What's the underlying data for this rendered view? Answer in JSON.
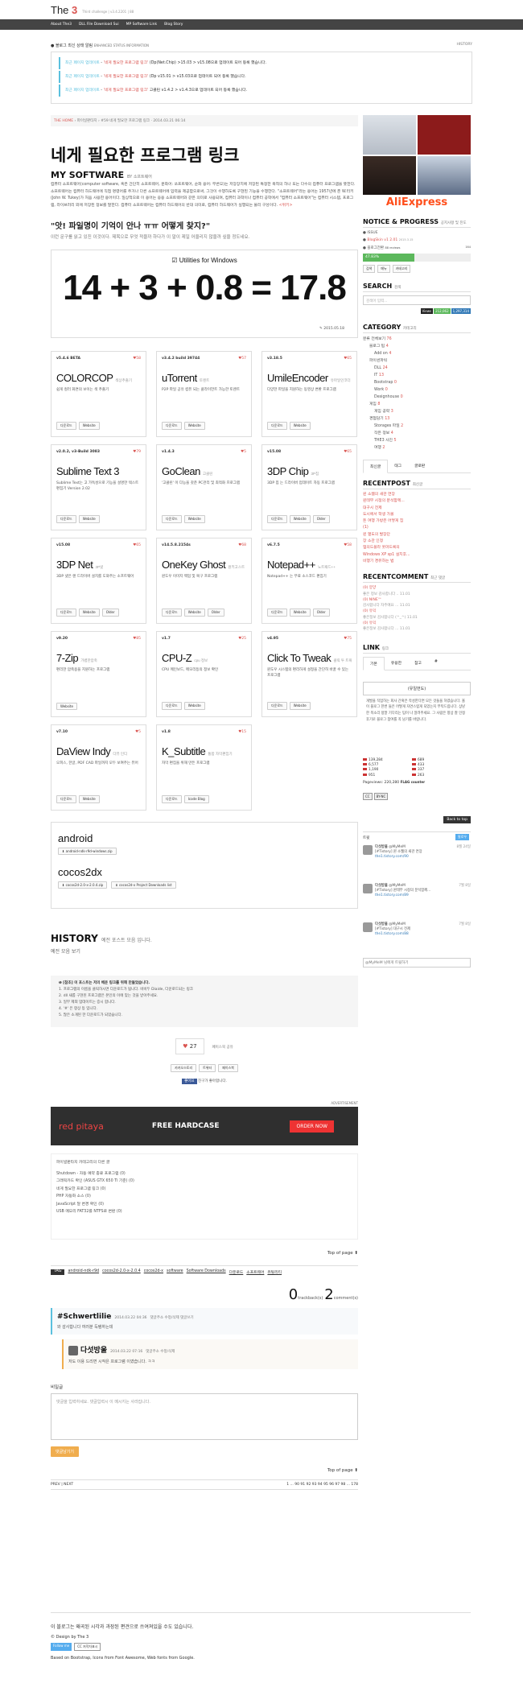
{
  "header": {
    "brand_prefix": "The",
    "brand_suffix": "3",
    "tagline": "Third challenge | v3.4.2201 | 88",
    "nav": [
      "About The3",
      "DLL File Download Sui",
      "MP Software Link",
      "Blog Story"
    ]
  },
  "status": {
    "title": "블로그 최신 상태 알림",
    "title_en": "ENHANCED STATUS INFORMATION",
    "history": "HISTORY",
    "items": [
      {
        "pre": "최근 페이지 업데이트",
        "link": "'네게 필요한 프로그램 링크'",
        "text": "(Dp(Net.Chip) >15.03 > v15.08으로 업데이트 되어 등록 했습니다."
      },
      {
        "pre": "최근 페이지 업데이트",
        "link": "'네게 필요한 프로그램 링크'",
        "text": "(Dp v15.01 > v15.03으로 업데이트 되어 등록 했습니다."
      },
      {
        "pre": "최근 페이지 업데이트",
        "link": "'네게 필요한 프로그램 링크'",
        "text": "고클린 v1.4.2 > v1.4.3으로 업데이트 되어 등록 했습니다."
      }
    ]
  },
  "breadcrumb": {
    "home": "THE HOME",
    "cat": "파이널판타지",
    "post": "#59 네게 필요한 프로그램 링크",
    "date": "2014.03.21 06:14"
  },
  "post": {
    "title": "네게 필요한 프로그램 링크",
    "subtitle": "MY SOFTWARE",
    "subtitle_small": "BY 소프트웨어",
    "intro": "컴퓨터 소프트웨어(computer software, 혹은 간단히 소프트웨어, 문화어: 쏘프트웨어, 순화 용어: 무른모)는 저장장치에 저장된 특정한 목적의 하나 또는 다수의 컴퓨터 프로그램을 뜻한다. 소프트웨어는 컴퓨터 하드웨어에 직접 명령어를 주거나 다른 소프트웨어에 입력을 제공함으로써, 그것이 수행하도록 구현된 기능을 수행한다. \"소프트웨어\"라는 용어는 1957년에 존 W.터키(John W. Tukey)가 처음 사용한 용어이다. 일상적으로 이 용어는 응용 소프트웨어와 같은 의미로 사용되며, 컴퓨터 과학이나 컴퓨터 공학에서 \"컴퓨터 소프트웨어\"는 컴퓨터 시스템, 프로그램, 라이브러리 외에 저장된 정보를 말한다. 컴퓨터 소프트웨어는 컴퓨터 하드웨어의 반대 의미로, 컴퓨터 하드웨어가 실행되는 물리 구성이다.",
    "intro_link": "<위키>",
    "q_title": "\"앗! 파일명이 기억이 안나 ㅠㅠ 어떻게 찾지?\"",
    "q_sub": "이런 문구를 읽고 있진 이것이다. 제목으로 무엇 적을까 하다가 이 말이 제일 어울리지 않을까 싶을 정도네요."
  },
  "utilities": {
    "label": "Utilities for Windows",
    "equation": "14 + 3 + 0.8 = 17.8",
    "date": "2015.05.18"
  },
  "cards": [
    {
      "ver": "v5.4.6 BETA",
      "likes": "58",
      "name": "COLORCOP",
      "small": "색상추출기",
      "desc": "쉽게 컬러 화면의 보이는 색 추출기",
      "btns": [
        "다운로드",
        "Website"
      ]
    },
    {
      "ver": "v3.4.2 build 39744",
      "likes": "57",
      "name": "uTorrent",
      "small": "토렌트",
      "desc": "P2P 파일 공유 컴퓨 되는 클라이언트 가능한 토렌트",
      "btns": [
        "다운로드",
        "Website"
      ]
    },
    {
      "ver": "v3.18.5",
      "likes": "65",
      "name": "UmileEncoder",
      "small": "유마일인코더",
      "desc": "다양한 파일을 지원하는 동영상 변환 프로그램",
      "btns": [
        "다운로드",
        "Website"
      ]
    },
    {
      "ver": "v2.0.2, v3-Build 3083",
      "likes": "79",
      "name": "Sublime Text 3",
      "small": "",
      "desc": "Sublime Text는 고 가독성으로 기능을 설명한 텍스트 편집기 Version 2.02",
      "btns": [
        "다운로드",
        "Website"
      ]
    },
    {
      "ver": "v1.4.3",
      "likes": "5",
      "name": "GoClean",
      "small": "고클린",
      "desc": "'고클린' 이 다능을 갖춘 PC관리 및 최적화 프로그램",
      "btns": [
        "다운로드",
        "Website"
      ]
    },
    {
      "ver": "v15.08",
      "likes": "65",
      "name": "3DP Chip",
      "small": "3P칩",
      "desc": "3DP 칩 는 드라이버 업데이트 자동 프로그램",
      "btns": [
        "다운로드",
        "Website",
        "Older"
      ]
    },
    {
      "ver": "v15.08",
      "likes": "65",
      "name": "3DP Net",
      "small": "3P넷",
      "desc": "3DP 넷은 랜 드라이버 설치를 도와주는 소프트웨어",
      "btns": [
        "다운로드",
        "Website",
        "Older"
      ]
    },
    {
      "ver": "v14.5.8.2154s",
      "likes": "68",
      "name": "OneKey Ghost",
      "small": "원키고스트",
      "desc": "윈도우 이미지 백업 및 복구 프로그램",
      "btns": [
        "다운로드",
        "Website",
        "Older"
      ]
    },
    {
      "ver": "v6.7.5",
      "likes": "58",
      "name": "Notepad++",
      "small": "노트패드++",
      "desc": "Notepad++ 는 무료 소스코드 편집기",
      "btns": [
        "다운로드",
        "Website",
        "Older"
      ]
    },
    {
      "ver": "v9.20",
      "likes": "85",
      "name": "7-Zip",
      "small": "가볍한압축",
      "desc": "편리한 압축용을 지원하는 프로그램",
      "btns": [
        "Website"
      ]
    },
    {
      "ver": "v1.7",
      "likes": "25",
      "name": "CPU-Z",
      "small": "cpu 정보",
      "desc": "CPU 메인보드, 메모리등의 정보 확인",
      "btns": [
        "다운로드",
        "Website"
      ]
    },
    {
      "ver": "v4.95",
      "likes": "75",
      "name": "Click To Tweak",
      "small": "클릭 투 트윅",
      "desc": "윈도우 시스템의 편리하게 설정을 간단히 바꿀 수 있는 프로그램",
      "btns": [
        "다운로드",
        "Website"
      ]
    },
    {
      "ver": "v7.10",
      "likes": "5",
      "name": "DaView Indy",
      "small": "다뷰 인디",
      "desc": "오피스, 한글, PDF CAD 파일까지 모두 보여주는 뷰어",
      "btns": [
        "다운로드",
        "Website"
      ]
    },
    {
      "ver": "v1.8",
      "likes": "15",
      "name": "K_Subtitle",
      "small": "통합 자막편집기",
      "desc": "자막 편집을 위해 만든 프로그램",
      "btns": [
        "다운로드",
        "Icode Blog"
      ]
    }
  ],
  "android": {
    "title": "android",
    "btn1": "android-ndk-r9d-windows.zip",
    "title2": "cocos2dx",
    "btn2": "cocos2d-2.0-x-2.0.4.zip",
    "btn3": "cocos2d-x Project Downloads list"
  },
  "history": {
    "title": "HISTORY",
    "title_small": "예전 포스트 모음 입니다.",
    "text": "예전 모음 보기"
  },
  "notice": {
    "head": "[참조] 이 포스트는 저의 배운 링크를 위해 만들었습니다.",
    "lines": [
      "1. 프로그램의 이름을 클릭하시면 다운로드가 됩니다. 비비두 Diaide, 다운로드되는 링크",
      "2. dll 새롭 구현된 프로그램은 본인의 이에 맞는 것을 받아주세요.",
      "3. 일부 제외 업데이트는 증시 합니다.",
      "4. '#' 은 항상 등 입니다.",
      "5. 많은 소개된 한 다운로드가 되었습니다."
    ]
  },
  "like": {
    "count": "27",
    "text": "페이스북 공유"
  },
  "shares": [
    "카카오스토리",
    "트위터",
    "페이스북"
  ],
  "fb": {
    "btn": "좋아요",
    "text": "친구가 좋아합니다."
  },
  "ad": {
    "label": "ADVERTISEMENT",
    "logo": "red pitaya",
    "headline": "FREE HARDCASE",
    "order": "ORDER NOW"
  },
  "related": {
    "head": "파이널판타지 카테고리의 다른 글",
    "items": [
      "Shutdown - 자동 예약 종료 프로그램 (0)",
      "그래픽카드 확인 (ASUS GTX 650 Ti 기준) (0)",
      "네게 필요한 프로그램 링크 (0)",
      "PHP 자동화 소스 (0)",
      "JavaScript 달 변경 확인 (0)",
      "USB 메모리 FAT32를 NTFS로 변환 (0)"
    ]
  },
  "top": "Top of page",
  "tags": {
    "label": "TAG",
    "items": [
      "android-ndk-r9d",
      "cocos2d-2.0-x-2.0.4",
      "cocos2d-x",
      "software",
      "Software Downloads",
      "다운로드",
      "소프트웨어",
      "유틸리티"
    ]
  },
  "trackback": {
    "tb_count": "0",
    "tb_label": "trackback(s)",
    "c_count": "2",
    "c_label": "comment(s)"
  },
  "comments": [
    {
      "name": "#Schwertlilie",
      "date": "2014.03.22 04:36",
      "actions": "댓글주소 수정/삭제 댓글쓰기",
      "text": "와 감사합니다 여러분 득템하는데"
    },
    {
      "name": "다섯방울",
      "date": "2014.03.22 07:16",
      "actions": "댓글주소 수정/삭제",
      "text": "저도 이용 드리면 시작은 프로그램 이였습니다. ㅋㅋ"
    }
  ],
  "comment_form": {
    "label": "비밀글",
    "placeholder": "댓글을 입력하세요. 댓글입력시 이 메시지는 사라집니다.",
    "submit": "댓글남기기"
  },
  "pager": {
    "prev": "PREV | NEXT",
    "pages": "1 ... 90 91 92 93 94 95 96 97 98 ... 178"
  },
  "footer": {
    "line1": "이 블로그는 왜곡된 시각과 과장된 편견으로 쓰여져있을 수도 있습니다.",
    "design": "© Design by The 3",
    "badges": [
      "Follow me",
      "CC 저작자표시"
    ],
    "credit": "Based on Bootstrap, Icons from Font Awesome, Web fonts from Google."
  },
  "sidebar": {
    "aliexpress": "AliExpress",
    "notice_title": "NOTICE",
    "progress_title": "PROGRESS",
    "notice_small": "공지사항 및 진도",
    "notice_items": [
      "ISSUE",
      "BlogSkin v1 2.01",
      "2015.3.15"
    ],
    "progress_label": "블로그전환",
    "progress_count": "88 reviews",
    "progress_max": "164",
    "progress_pct": "47.83%",
    "progress_value": 0.4783,
    "sel": [
      "검색",
      "메뉴",
      "카테고리"
    ],
    "search_title": "SEARCH",
    "search_sub": "검색",
    "search_placeholder": "검색어 입력...",
    "views": [
      "Views",
      "212,062",
      "1,297,314"
    ],
    "cat_title": "CATEGORY",
    "cat_sub": "카테고리",
    "cats": [
      {
        "t": "분류 전체보기",
        "n": "76",
        "l": 0
      },
      {
        "t": "블로그 팁",
        "n": "4",
        "l": 1
      },
      {
        "t": "Add on",
        "n": "4",
        "l": 2
      },
      {
        "t": "파이썬파워",
        "n": "",
        "l": 1
      },
      {
        "t": "DLL",
        "n": "24",
        "l": 2
      },
      {
        "t": "IT",
        "n": "13",
        "l": 2
      },
      {
        "t": "Bootstrap",
        "n": "0",
        "l": 2
      },
      {
        "t": "Work",
        "n": "0",
        "l": 2
      },
      {
        "t": "Designhouse",
        "n": "0",
        "l": 2
      },
      {
        "t": "게임",
        "n": "8",
        "l": 1
      },
      {
        "t": "게임 공략",
        "n": "3",
        "l": 2
      },
      {
        "t": "경험담기",
        "n": "13",
        "l": 1
      },
      {
        "t": "Storages 파일",
        "n": "2",
        "l": 2
      },
      {
        "t": "작은 정보",
        "n": "4",
        "l": 2
      },
      {
        "t": "THE3 사진",
        "n": "5",
        "l": 2
      },
      {
        "t": "여행",
        "n": "2",
        "l": 2
      }
    ],
    "tabs": [
      "최신글",
      "태그",
      "글로판"
    ],
    "rp_title": "RECENTPOST",
    "rp_sub": "최신글",
    "rp": [
      "윈 소웹의 새관 연장",
      "윈테무 시정의 분석함께...",
      "대구시 전제",
      "도시에서 학생 가볼",
      "돈 여행 가방은 어떻게 집",
      "(1)",
      "윈 열도의 발장단",
      "장 소관 인정",
      "맴의드블라 웃마드록의",
      "Windows XP sp1 설치후...",
      "비행기 경유하는 법"
    ],
    "rc_title": "RECENTCOMMENT",
    "rc_sub": "최근 댓글",
    "rc": [
      {
        "a": "(0) 양양",
        "b": "좋은 정보 감사합니다 .. 11.01"
      },
      {
        "a": "(0) NINE™",
        "b": "감사합니다 자주애요 ... 11.01"
      },
      {
        "a": "(0) 유익",
        "b": "좋은정보 감사합니다 (^_^) 11.01"
      },
      {
        "a": "(0) 유익",
        "b": "좋은정보 감사합니다 ... 11.01"
      }
    ],
    "link_title": "LINK",
    "link_sub": "링크",
    "link_tabs": [
      "기본",
      "유용한",
      "참고",
      "#"
    ],
    "blog_title": "(유일먼도)",
    "blog_text": "개발을 직업하는 회사 간혹은 작성한다면 모든 것들을 하였습니다. 올 이 블로그 한번 들은 어떻게 자연스럽게 되었는지 부탁드립니다. 상냥한 목소리 정말 기다리는 팀이 나 알려주세요. 그 사람은 항상 잘 인정 후기로 블로그 참여를 꼭 남기를 바랍니다.",
    "flags": [
      "139,284",
      "689",
      "248",
      "6,577",
      "433",
      "230",
      "1,190",
      "337",
      "227",
      "951",
      "263",
      "201"
    ],
    "pageviews": "Pageviews: 220,280",
    "flagcounter": "FLAG counter",
    "cc": [
      "CC",
      "BY-NC"
    ],
    "backtotop": "Back to top",
    "tweets_title": "트윗",
    "follow": "팔로우",
    "tweets": [
      {
        "n": "다섯방울",
        "h": "@MyMeM",
        "t": "[#Tistory] 윈 소웹의 새관 연장",
        "l": "the1.tistory.com/90",
        "d": "8월 24일"
      },
      {
        "n": "다섯방울",
        "h": "@MyMeM",
        "t": "[#Tistory] 윈테무 시정의 분석함께...",
        "l": "the1.tistory.com/89",
        "d": "7월 8일"
      },
      {
        "n": "다섯방울",
        "h": "@MyMeM",
        "t": "[#Tistory] 대구시 전제",
        "l": "the1.tistory.com/88",
        "d": "7월 8일"
      }
    ],
    "tw_input": "@MyMeM 님에게 트윗하기"
  }
}
